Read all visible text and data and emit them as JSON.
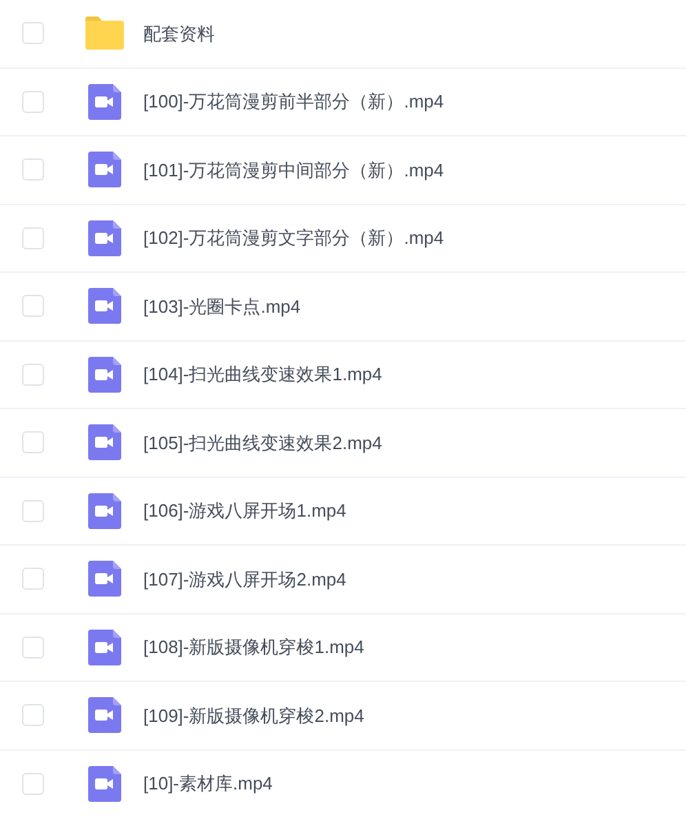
{
  "files": [
    {
      "kind": "folder",
      "name": "配套资料",
      "checked": false
    },
    {
      "kind": "video",
      "name": "[100]-万花筒漫剪前半部分（新）.mp4",
      "checked": false
    },
    {
      "kind": "video",
      "name": "[101]-万花筒漫剪中间部分（新）.mp4",
      "checked": false
    },
    {
      "kind": "video",
      "name": "[102]-万花筒漫剪文字部分（新）.mp4",
      "checked": false
    },
    {
      "kind": "video",
      "name": "[103]-光圈卡点.mp4",
      "checked": false
    },
    {
      "kind": "video",
      "name": "[104]-扫光曲线变速效果1.mp4",
      "checked": false
    },
    {
      "kind": "video",
      "name": "[105]-扫光曲线变速效果2.mp4",
      "checked": false
    },
    {
      "kind": "video",
      "name": "[106]-游戏八屏开场1.mp4",
      "checked": false
    },
    {
      "kind": "video",
      "name": "[107]-游戏八屏开场2.mp4",
      "checked": false
    },
    {
      "kind": "video",
      "name": "[108]-新版摄像机穿梭1.mp4",
      "checked": false
    },
    {
      "kind": "video",
      "name": "[109]-新版摄像机穿梭2.mp4",
      "checked": false
    },
    {
      "kind": "video",
      "name": "[10]-素材库.mp4",
      "checked": false
    }
  ]
}
